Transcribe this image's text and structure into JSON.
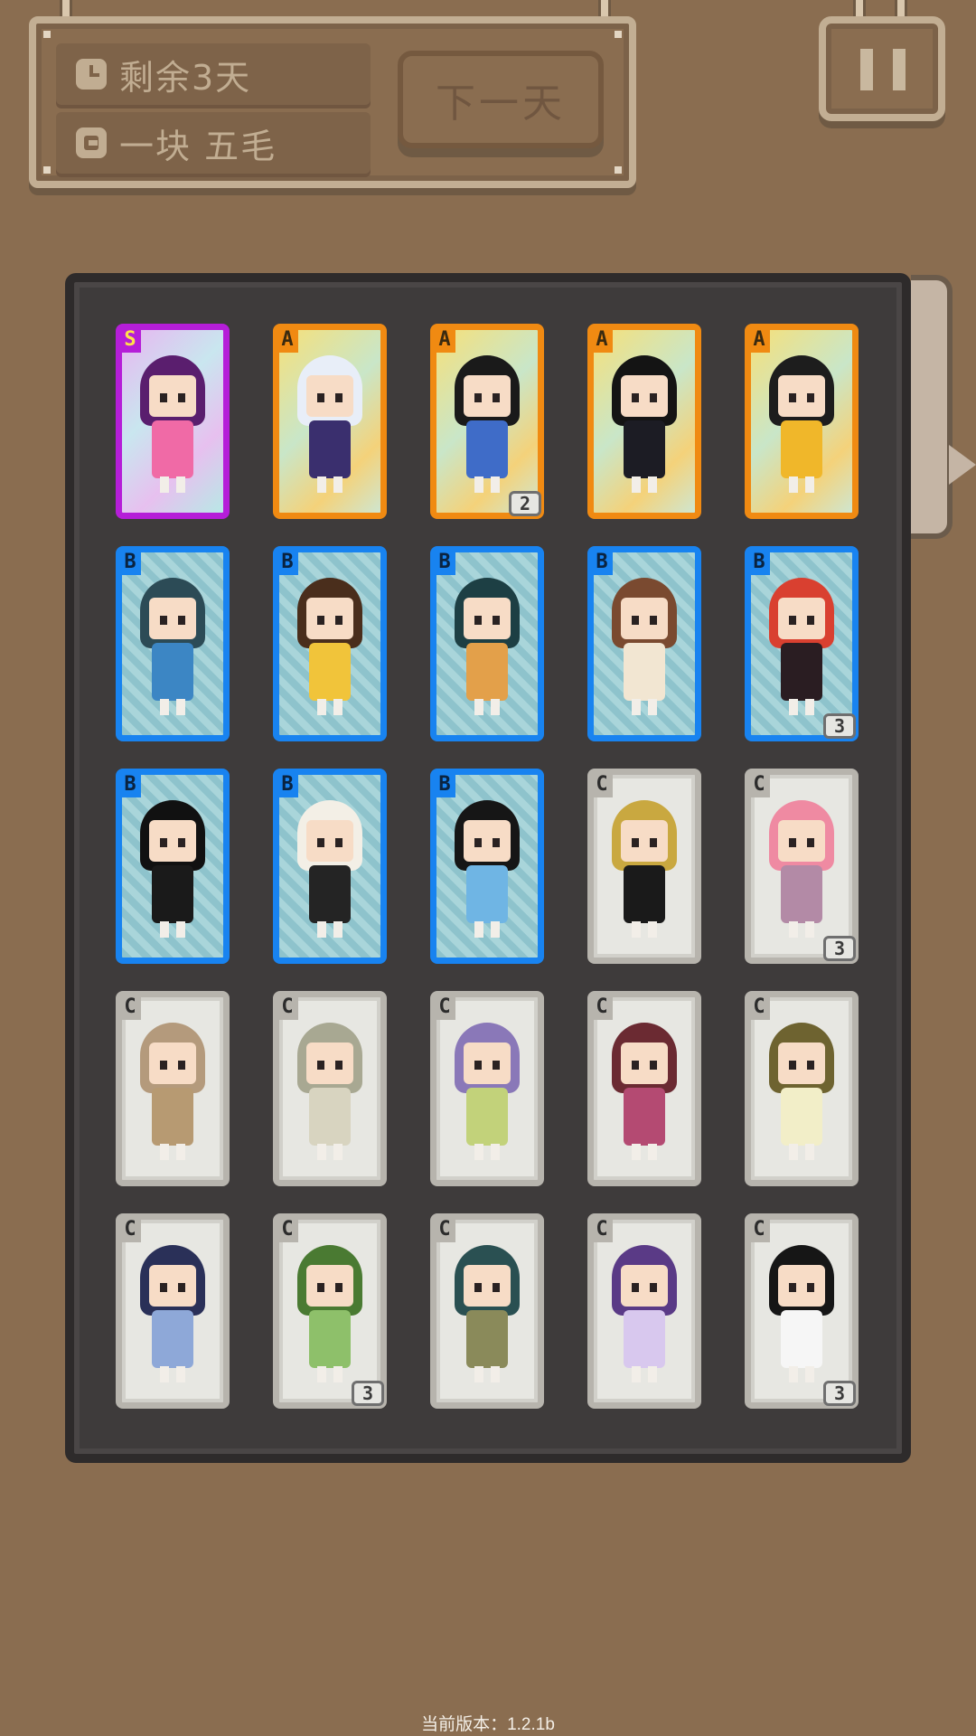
{
  "header": {
    "days_left": "剩余3天",
    "money": "一块 五毛",
    "next_day_label": "下一天"
  },
  "icons": {
    "clock": "clock-icon",
    "coin": "coin-icon",
    "pause": "pause-icon"
  },
  "colors": {
    "background": "#8a6d50",
    "rank_S": "#b51ed8",
    "rank_A": "#f08a12",
    "rank_B": "#1883f0",
    "rank_C": "#b7b4ad"
  },
  "cards": [
    {
      "rank": "S",
      "count": "",
      "hair": "#5a1e6e",
      "outfit": "#f06aa6"
    },
    {
      "rank": "A",
      "count": "",
      "hair": "#e8eef8",
      "outfit": "#3a2f6e"
    },
    {
      "rank": "A",
      "count": "2",
      "hair": "#1a1a1a",
      "outfit": "#3f6cc8"
    },
    {
      "rank": "A",
      "count": "",
      "hair": "#141414",
      "outfit": "#1c1c24"
    },
    {
      "rank": "A",
      "count": "",
      "hair": "#1d1d1d",
      "outfit": "#f0b72a"
    },
    {
      "rank": "B",
      "count": "",
      "hair": "#2c4b56",
      "outfit": "#3c86c4"
    },
    {
      "rank": "B",
      "count": "",
      "hair": "#4a2e1c",
      "outfit": "#f1c43a"
    },
    {
      "rank": "B",
      "count": "",
      "hair": "#1d3f44",
      "outfit": "#e3a04a"
    },
    {
      "rank": "B",
      "count": "",
      "hair": "#7a4a30",
      "outfit": "#f2e6d2"
    },
    {
      "rank": "B",
      "count": "3",
      "hair": "#d94030",
      "outfit": "#2a1d22"
    },
    {
      "rank": "B",
      "count": "",
      "hair": "#111111",
      "outfit": "#1a1a1a"
    },
    {
      "rank": "B",
      "count": "",
      "hair": "#f3efe6",
      "outfit": "#242424"
    },
    {
      "rank": "B",
      "count": "",
      "hair": "#161616",
      "outfit": "#6fb5e4"
    },
    {
      "rank": "C",
      "count": "",
      "hair": "#c9a840",
      "outfit": "#1a1a1a"
    },
    {
      "rank": "C",
      "count": "3",
      "hair": "#ef8aa2",
      "outfit": "#b38aa6"
    },
    {
      "rank": "C",
      "count": "",
      "hair": "#b49a7c",
      "outfit": "#b79a72"
    },
    {
      "rank": "C",
      "count": "",
      "hair": "#a8a892",
      "outfit": "#d8d4c0"
    },
    {
      "rank": "C",
      "count": "",
      "hair": "#8a78b8",
      "outfit": "#c2d27a"
    },
    {
      "rank": "C",
      "count": "",
      "hair": "#6b2a32",
      "outfit": "#b44a72"
    },
    {
      "rank": "C",
      "count": "",
      "hair": "#6e6330",
      "outfit": "#f2eec8"
    },
    {
      "rank": "C",
      "count": "",
      "hair": "#2a3058",
      "outfit": "#8ea8d8"
    },
    {
      "rank": "C",
      "count": "3",
      "hair": "#4a7a32",
      "outfit": "#8ec06a"
    },
    {
      "rank": "C",
      "count": "",
      "hair": "#2a5052",
      "outfit": "#8a8a5a"
    },
    {
      "rank": "C",
      "count": "",
      "hair": "#5a3a86",
      "outfit": "#d8c8ee"
    },
    {
      "rank": "C",
      "count": "3",
      "hair": "#161616",
      "outfit": "#f6f6f6"
    }
  ],
  "footer": {
    "version": "当前版本：1.2.1b"
  }
}
